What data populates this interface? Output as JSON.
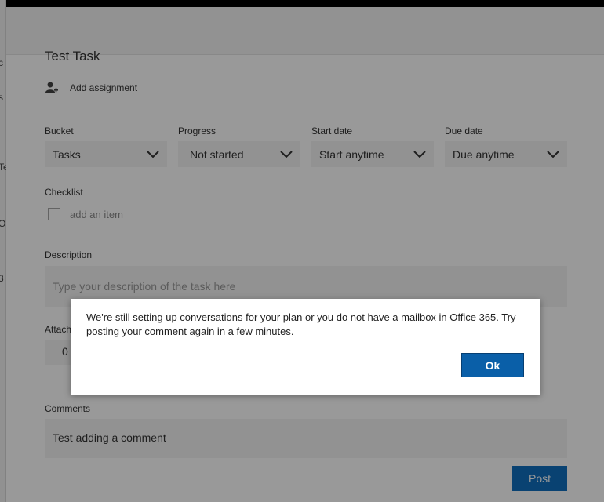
{
  "task": {
    "title": "Test Task",
    "add_assignment": "Add assignment"
  },
  "fields": {
    "bucket": {
      "label": "Bucket",
      "value": "Tasks"
    },
    "progress": {
      "label": "Progress",
      "value": "Not started"
    },
    "start_date": {
      "label": "Start date",
      "value": "Start anytime"
    },
    "due_date": {
      "label": "Due date",
      "value": "Due anytime"
    }
  },
  "checklist": {
    "label": "Checklist",
    "placeholder": "add an item"
  },
  "description": {
    "label": "Description",
    "placeholder": "Type your description of the task here"
  },
  "attachments": {
    "label": "Attach",
    "button_glyph": "0"
  },
  "comments": {
    "label": "Comments",
    "value": "Test adding a comment",
    "post_label": "Post"
  },
  "left_strip": {
    "fragments": [
      "c",
      "s",
      "Te",
      "O",
      "3"
    ]
  },
  "dialog": {
    "message": "We're still setting up conversations for your plan or you do not have a mailbox in Office 365. Try posting your comment again in a few minutes.",
    "ok_label": "Ok"
  },
  "colors": {
    "accent": "#106ebe",
    "ok_button": "#0a5fa8",
    "overlay": "rgba(0,0,0,0.4)"
  }
}
